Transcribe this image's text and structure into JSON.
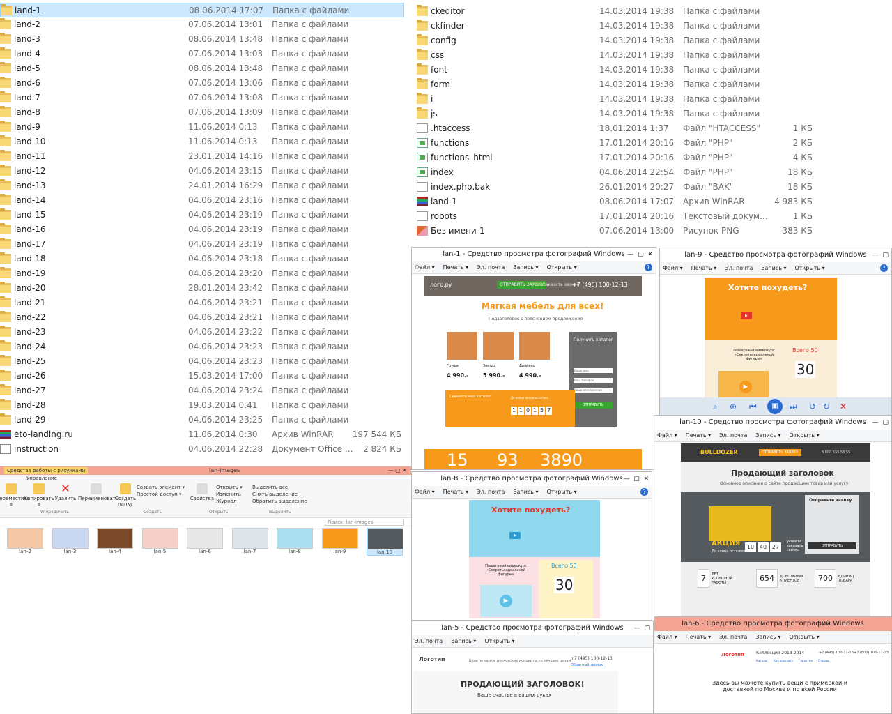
{
  "left_list": [
    {
      "name": "land-1",
      "date": "08.06.2014 17:07",
      "type": "Папка с файлами",
      "size": "",
      "icon": "folder"
    },
    {
      "name": "land-2",
      "date": "07.06.2014 13:01",
      "type": "Папка с файлами",
      "size": "",
      "icon": "folder"
    },
    {
      "name": "land-3",
      "date": "08.06.2014 13:48",
      "type": "Папка с файлами",
      "size": "",
      "icon": "folder"
    },
    {
      "name": "land-4",
      "date": "07.06.2014 13:03",
      "type": "Папка с файлами",
      "size": "",
      "icon": "folder"
    },
    {
      "name": "land-5",
      "date": "08.06.2014 13:48",
      "type": "Папка с файлами",
      "size": "",
      "icon": "folder"
    },
    {
      "name": "land-6",
      "date": "07.06.2014 13:06",
      "type": "Папка с файлами",
      "size": "",
      "icon": "folder"
    },
    {
      "name": "land-7",
      "date": "07.06.2014 13:08",
      "type": "Папка с файлами",
      "size": "",
      "icon": "folder"
    },
    {
      "name": "land-8",
      "date": "07.06.2014 13:09",
      "type": "Папка с файлами",
      "size": "",
      "icon": "folder"
    },
    {
      "name": "land-9",
      "date": "11.06.2014 0:13",
      "type": "Папка с файлами",
      "size": "",
      "icon": "folder"
    },
    {
      "name": "land-10",
      "date": "11.06.2014 0:13",
      "type": "Папка с файлами",
      "size": "",
      "icon": "folder"
    },
    {
      "name": "land-11",
      "date": "23.01.2014 14:16",
      "type": "Папка с файлами",
      "size": "",
      "icon": "folder"
    },
    {
      "name": "land-12",
      "date": "04.06.2014 23:15",
      "type": "Папка с файлами",
      "size": "",
      "icon": "folder"
    },
    {
      "name": "land-13",
      "date": "24.01.2014 16:29",
      "type": "Папка с файлами",
      "size": "",
      "icon": "folder"
    },
    {
      "name": "land-14",
      "date": "04.06.2014 23:16",
      "type": "Папка с файлами",
      "size": "",
      "icon": "folder"
    },
    {
      "name": "land-15",
      "date": "04.06.2014 23:19",
      "type": "Папка с файлами",
      "size": "",
      "icon": "folder"
    },
    {
      "name": "land-16",
      "date": "04.06.2014 23:19",
      "type": "Папка с файлами",
      "size": "",
      "icon": "folder"
    },
    {
      "name": "land-17",
      "date": "04.06.2014 23:19",
      "type": "Папка с файлами",
      "size": "",
      "icon": "folder"
    },
    {
      "name": "land-18",
      "date": "04.06.2014 23:18",
      "type": "Папка с файлами",
      "size": "",
      "icon": "folder"
    },
    {
      "name": "land-19",
      "date": "04.06.2014 23:20",
      "type": "Папка с файлами",
      "size": "",
      "icon": "folder"
    },
    {
      "name": "land-20",
      "date": "28.01.2014 23:42",
      "type": "Папка с файлами",
      "size": "",
      "icon": "folder"
    },
    {
      "name": "land-21",
      "date": "04.06.2014 23:21",
      "type": "Папка с файлами",
      "size": "",
      "icon": "folder"
    },
    {
      "name": "land-22",
      "date": "04.06.2014 23:21",
      "type": "Папка с файлами",
      "size": "",
      "icon": "folder"
    },
    {
      "name": "land-23",
      "date": "04.06.2014 23:22",
      "type": "Папка с файлами",
      "size": "",
      "icon": "folder"
    },
    {
      "name": "land-24",
      "date": "04.06.2014 23:23",
      "type": "Папка с файлами",
      "size": "",
      "icon": "folder"
    },
    {
      "name": "land-25",
      "date": "04.06.2014 23:23",
      "type": "Папка с файлами",
      "size": "",
      "icon": "folder"
    },
    {
      "name": "land-26",
      "date": "15.03.2014 17:00",
      "type": "Папка с файлами",
      "size": "",
      "icon": "folder"
    },
    {
      "name": "land-27",
      "date": "04.06.2014 23:24",
      "type": "Папка с файлами",
      "size": "",
      "icon": "folder"
    },
    {
      "name": "land-28",
      "date": "19.03.2014 0:41",
      "type": "Папка с файлами",
      "size": "",
      "icon": "folder"
    },
    {
      "name": "land-29",
      "date": "04.06.2014 23:25",
      "type": "Папка с файлами",
      "size": "",
      "icon": "folder"
    },
    {
      "name": "eto-landing.ru",
      "date": "11.06.2014 0:30",
      "type": "Архив WinRAR",
      "size": "197 544 КБ",
      "icon": "rar"
    },
    {
      "name": "instruction",
      "date": "04.06.2014 22:28",
      "type": "Документ Office ...",
      "size": "2 824 КБ",
      "icon": "doc"
    }
  ],
  "right_list": [
    {
      "name": "ckeditor",
      "date": "14.03.2014 19:38",
      "type": "Папка с файлами",
      "size": "",
      "icon": "folder"
    },
    {
      "name": "ckfinder",
      "date": "14.03.2014 19:38",
      "type": "Папка с файлами",
      "size": "",
      "icon": "folder"
    },
    {
      "name": "config",
      "date": "14.03.2014 19:38",
      "type": "Папка с файлами",
      "size": "",
      "icon": "folder"
    },
    {
      "name": "css",
      "date": "14.03.2014 19:38",
      "type": "Папка с файлами",
      "size": "",
      "icon": "folder"
    },
    {
      "name": "font",
      "date": "14.03.2014 19:38",
      "type": "Папка с файлами",
      "size": "",
      "icon": "folder"
    },
    {
      "name": "form",
      "date": "14.03.2014 19:38",
      "type": "Папка с файлами",
      "size": "",
      "icon": "folder"
    },
    {
      "name": "i",
      "date": "14.03.2014 19:38",
      "type": "Папка с файлами",
      "size": "",
      "icon": "folder"
    },
    {
      "name": "js",
      "date": "14.03.2014 19:38",
      "type": "Папка с файлами",
      "size": "",
      "icon": "folder"
    },
    {
      "name": ".htaccess",
      "date": "18.01.2014 1:37",
      "type": "Файл \"HTACCESS\"",
      "size": "1 КБ",
      "icon": "txt"
    },
    {
      "name": "functions",
      "date": "17.01.2014 20:16",
      "type": "Файл \"PHP\"",
      "size": "2 КБ",
      "icon": "php"
    },
    {
      "name": "functions_html",
      "date": "17.01.2014 20:16",
      "type": "Файл \"PHP\"",
      "size": "4 КБ",
      "icon": "php"
    },
    {
      "name": "index",
      "date": "04.06.2014 22:54",
      "type": "Файл \"PHP\"",
      "size": "18 КБ",
      "icon": "php"
    },
    {
      "name": "index.php.bak",
      "date": "26.01.2014 20:27",
      "type": "Файл \"BAK\"",
      "size": "18 КБ",
      "icon": "txt"
    },
    {
      "name": "land-1",
      "date": "08.06.2014 17:07",
      "type": "Архив WinRAR",
      "size": "4 983 КБ",
      "icon": "rar"
    },
    {
      "name": "robots",
      "date": "17.01.2014 20:16",
      "type": "Текстовый докум...",
      "size": "1 КБ",
      "icon": "txt"
    },
    {
      "name": "Без имени-1",
      "date": "07.06.2014 13:00",
      "type": "Рисунок PNG",
      "size": "383 КБ",
      "icon": "png"
    }
  ],
  "explorer": {
    "tab": "Средства работы с рисунками",
    "title": "lan-images",
    "subtab": "Управление",
    "buttons": [
      "Переместить в",
      "Копировать в",
      "Удалить",
      "Переименовать",
      "Создать папку",
      "Свойства"
    ],
    "small": [
      "Создать элемент ▾",
      "Простой доступ ▾",
      "Открыть ▾",
      "Изменить",
      "Журнал",
      "Выделить все",
      "Снять выделение",
      "Обратить выделение"
    ],
    "groups": [
      "Упорядочить",
      "Создать",
      "Открыть",
      "Выделить"
    ],
    "search": "Поиск: lan-images",
    "thumbs": [
      "lan-2",
      "lan-3",
      "lan-4",
      "lan-5",
      "lan-6",
      "lan-7",
      "lan-8",
      "lan-9",
      "lan-10"
    ]
  },
  "viewer_menu": [
    "Файл ▾",
    "Печать ▾",
    "Эл. почта",
    "Запись ▾",
    "Открыть ▾"
  ],
  "viewer_menu_short": [
    "Эл. почта",
    "Запись ▾",
    "Открыть ▾"
  ],
  "viewers": {
    "v1": {
      "title": "lan-1 - Средство просмотра фотографий Windows"
    },
    "v9": {
      "title": "lan-9 - Средство просмотра фотографий Windows"
    },
    "v10": {
      "title": "lan-10 - Средство просмотра фотографий Windows"
    },
    "v8": {
      "title": "lan-8 - Средство просмотра фотографий Windows"
    },
    "v5": {
      "title": "lan-5 - Средство просмотра фотографий Windows"
    },
    "v6": {
      "title": "lan-6 - Средство просмотра фотографий Windows"
    }
  },
  "lp1": {
    "logo": "лого.ру",
    "cta": "ОТПРАВИТЬ ЗАЯВКУ",
    "callback": "Заказать звонок",
    "phone": "+7 (495) 100-12-13",
    "headline": "Мягкая мебель для всех!",
    "subheadline": "Подзаголовок с пояснением предложения",
    "products": [
      {
        "name": "Груша",
        "price": "4 990.-"
      },
      {
        "name": "Звезда",
        "price": "5 990.-"
      },
      {
        "name": "Драйвер",
        "price": "4 990.-"
      }
    ],
    "form_title": "Получить каталог",
    "form_fields": [
      "Ваше имя",
      "Ваш телефон",
      "Ваша электронная"
    ],
    "form_button": "ОТПРАВИТЬ",
    "promo": "Скачайте наш каталог",
    "timer_title": "До конца акции осталось",
    "timer": [
      "1",
      "1",
      "0",
      "1",
      "5",
      "7"
    ],
    "stats": [
      "15",
      "93",
      "3890"
    ]
  },
  "lp9": {
    "headline": "Хотите похудеть?",
    "course": "Пошаговый видеокурс «Секреты идеальной фигуры»",
    "total": "Всего 50",
    "day": "30"
  },
  "lp8": {
    "headline": "Хотите похудеть?",
    "course": "Пошаговый видеокурс «Секреты идеальной фигуры»",
    "total": "Всего 50",
    "day": "30"
  },
  "lp10": {
    "logo": "BULLDOZER",
    "cta": "ОТПРАВИТЬ ЗАЯВКУ",
    "phone": "8 800 555 55 55",
    "headline": "Продающий заголовок",
    "subheadline": "Основное описание о сайте продающем товар или услугу",
    "form_title": "Отправьте заявку",
    "form_button": "ОТПРАВИТЬ",
    "promo": "АКЦИЯ",
    "promo_sub": "До конца осталось",
    "timer": [
      "10",
      "40",
      "27"
    ],
    "promo_right": "успейте заказать сейчас",
    "stats": [
      {
        "num": "7",
        "label": "ЛЕТ УСПЕШНОЙ РАБОТЫ"
      },
      {
        "num": "654",
        "label": "ДОВОЛЬНЫХ КЛИЕНТОВ"
      },
      {
        "num": "700",
        "label": "ЕДИНИЦ ТОВАРА"
      }
    ]
  },
  "lp5": {
    "logo": "Логотип",
    "tagline": "Билеты на все московские концерты по лучшим ценам",
    "phone": "+7 (495) 100-12-13",
    "callback": "Обратный звонок",
    "headline": "ПРОДАЮЩИЙ ЗАГОЛОВОК!",
    "subheadline": "Ваше счастье в ваших руках"
  },
  "lp6": {
    "logo": "Логотип",
    "collection": "Коллекция 2013-2014",
    "nav": [
      "Каталог",
      "Как заказать",
      "Гарантии",
      "Отзывы"
    ],
    "phone1": "+7 (495) 100-12-13",
    "phone2": "+7 (800) 100-12-13",
    "headline": "Здесь вы можете купить вещи с примеркой и доставкой по Москве и по всей России"
  },
  "colors": {
    "selection": "#cce8ff",
    "accent_orange": "#f79a1c",
    "cta_green": "#3aa52e",
    "title_red": "#f3a493"
  }
}
